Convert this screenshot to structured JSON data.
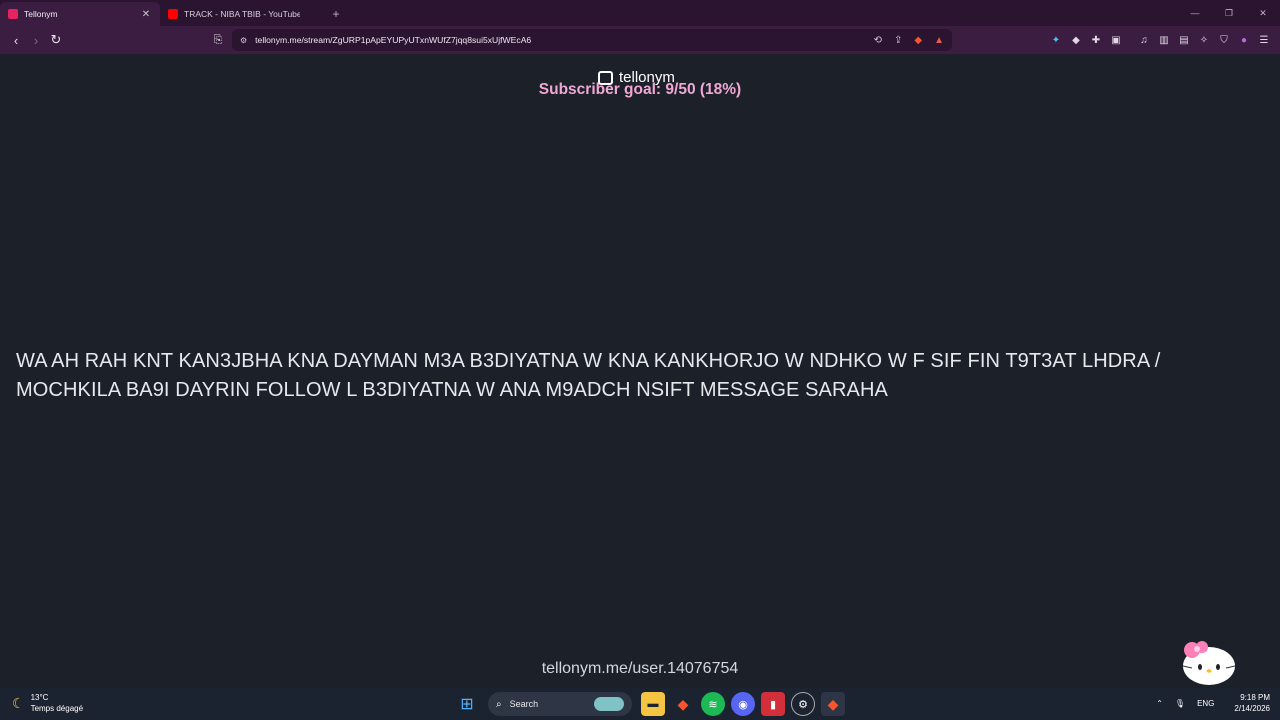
{
  "browser": {
    "tabs": [
      {
        "title": "Tellonym",
        "active": true,
        "favicon_color": "#e4245f"
      },
      {
        "title": "TRACK - NIBA TBIB - YouTube",
        "active": false,
        "favicon_color": "#ff0000"
      }
    ],
    "url": "tellonym.me/stream/ZgURP1pApEYUPyUTxnWUfZ7jqq8sui5xUjfWEcA6",
    "accent_color": "#3a1d40"
  },
  "page": {
    "logo_text": "tellonym",
    "subscriber_goal": "Subscriber goal: 9/50 (18%)",
    "message": "WA AH RAH KNT KAN3JBHA KNA DAYMAN M3A B3DIYATNA W KNA KANKHORJO W NDHKO W F SIF FIN T9T3AT LHDRA / MOCHKILA BA9I DAYRIN FOLLOW L B3DIYATNA W ANA M9ADCH NSIFT MESSAGE SARAHA",
    "user_link": "tellonym.me/user.14076754",
    "goal_color": "#f0a7d4",
    "background": "#1b2029"
  },
  "taskbar": {
    "weather_temp": "13°C",
    "weather_desc": "Temps dégagé",
    "search_label": "Search",
    "language": "ENG",
    "time": "9:18 PM",
    "date": "2/14/2026"
  }
}
